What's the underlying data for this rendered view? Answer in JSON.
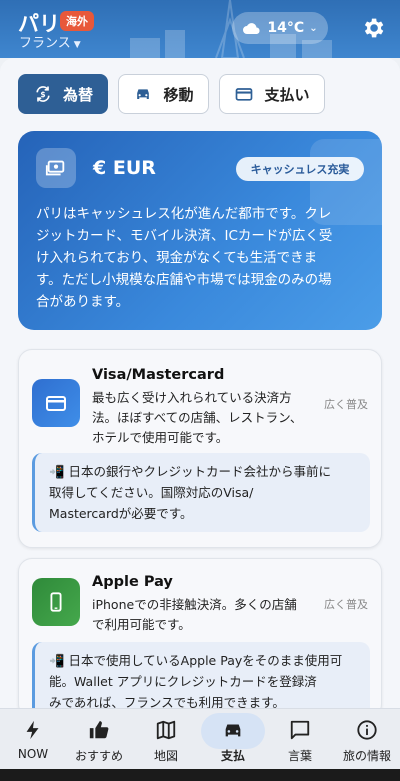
{
  "header": {
    "city": "パリ",
    "badge": "海外",
    "country": "フランス",
    "weather": {
      "icon": "cloud-sun-icon",
      "temp": "14°C"
    }
  },
  "tabs": [
    {
      "label": "為替",
      "icon": "currency-exchange-icon",
      "active": true
    },
    {
      "label": "移動",
      "icon": "car-icon",
      "active": false
    },
    {
      "label": "支払い",
      "icon": "card-icon",
      "active": false
    }
  ],
  "currency": {
    "title": "€ EUR",
    "badge": "キャッシュレス充実",
    "desc_lines": [
      "パリはキャッシュレス化が進んだ都市です。クレ",
      "ジットカード、モバイル決済、ICカードが広く受",
      "け入れられており、現金がなくても生活できま",
      "す。ただし小規模な店舗や市場では現金のみの場",
      "合があります。"
    ]
  },
  "payments": [
    {
      "name": "Visa/Mastercard",
      "tag": "広く普及",
      "desc_lines": [
        "最も広く受け入れられている決済方",
        "法。ほぼすべての店舗、レストラン、",
        "ホテルで使用可能です。"
      ],
      "note_lines": [
        "📲 日本の銀行やクレジットカード会社から事前に",
        "取得してください。国際対応のVisa/",
        "Mastercardが必要です。"
      ]
    },
    {
      "name": "Apple Pay",
      "tag": "広く普及",
      "desc_lines": [
        "iPhoneでの非接触決済。多くの店舗",
        "で利用可能です。"
      ],
      "note_lines": [
        "📲 日本で使用しているApple Payをそのまま使用可",
        "能。Wallet アプリにクレジットカードを登録済",
        "みであれば、フランスでも利用できます。"
      ]
    }
  ],
  "nav": [
    {
      "label": "NOW",
      "icon": "bolt-icon",
      "active": false
    },
    {
      "label": "おすすめ",
      "icon": "thumbs-up-icon",
      "active": false
    },
    {
      "label": "地図",
      "icon": "map-icon",
      "active": false
    },
    {
      "label": "支払",
      "icon": "car-icon",
      "active": true
    },
    {
      "label": "言葉",
      "icon": "chat-icon",
      "active": false
    },
    {
      "label": "旅の情報",
      "icon": "info-icon",
      "active": false
    }
  ],
  "colors": {
    "primary": "#2e5f95",
    "accent": "#3a89dc",
    "badge": "#e8583a"
  }
}
